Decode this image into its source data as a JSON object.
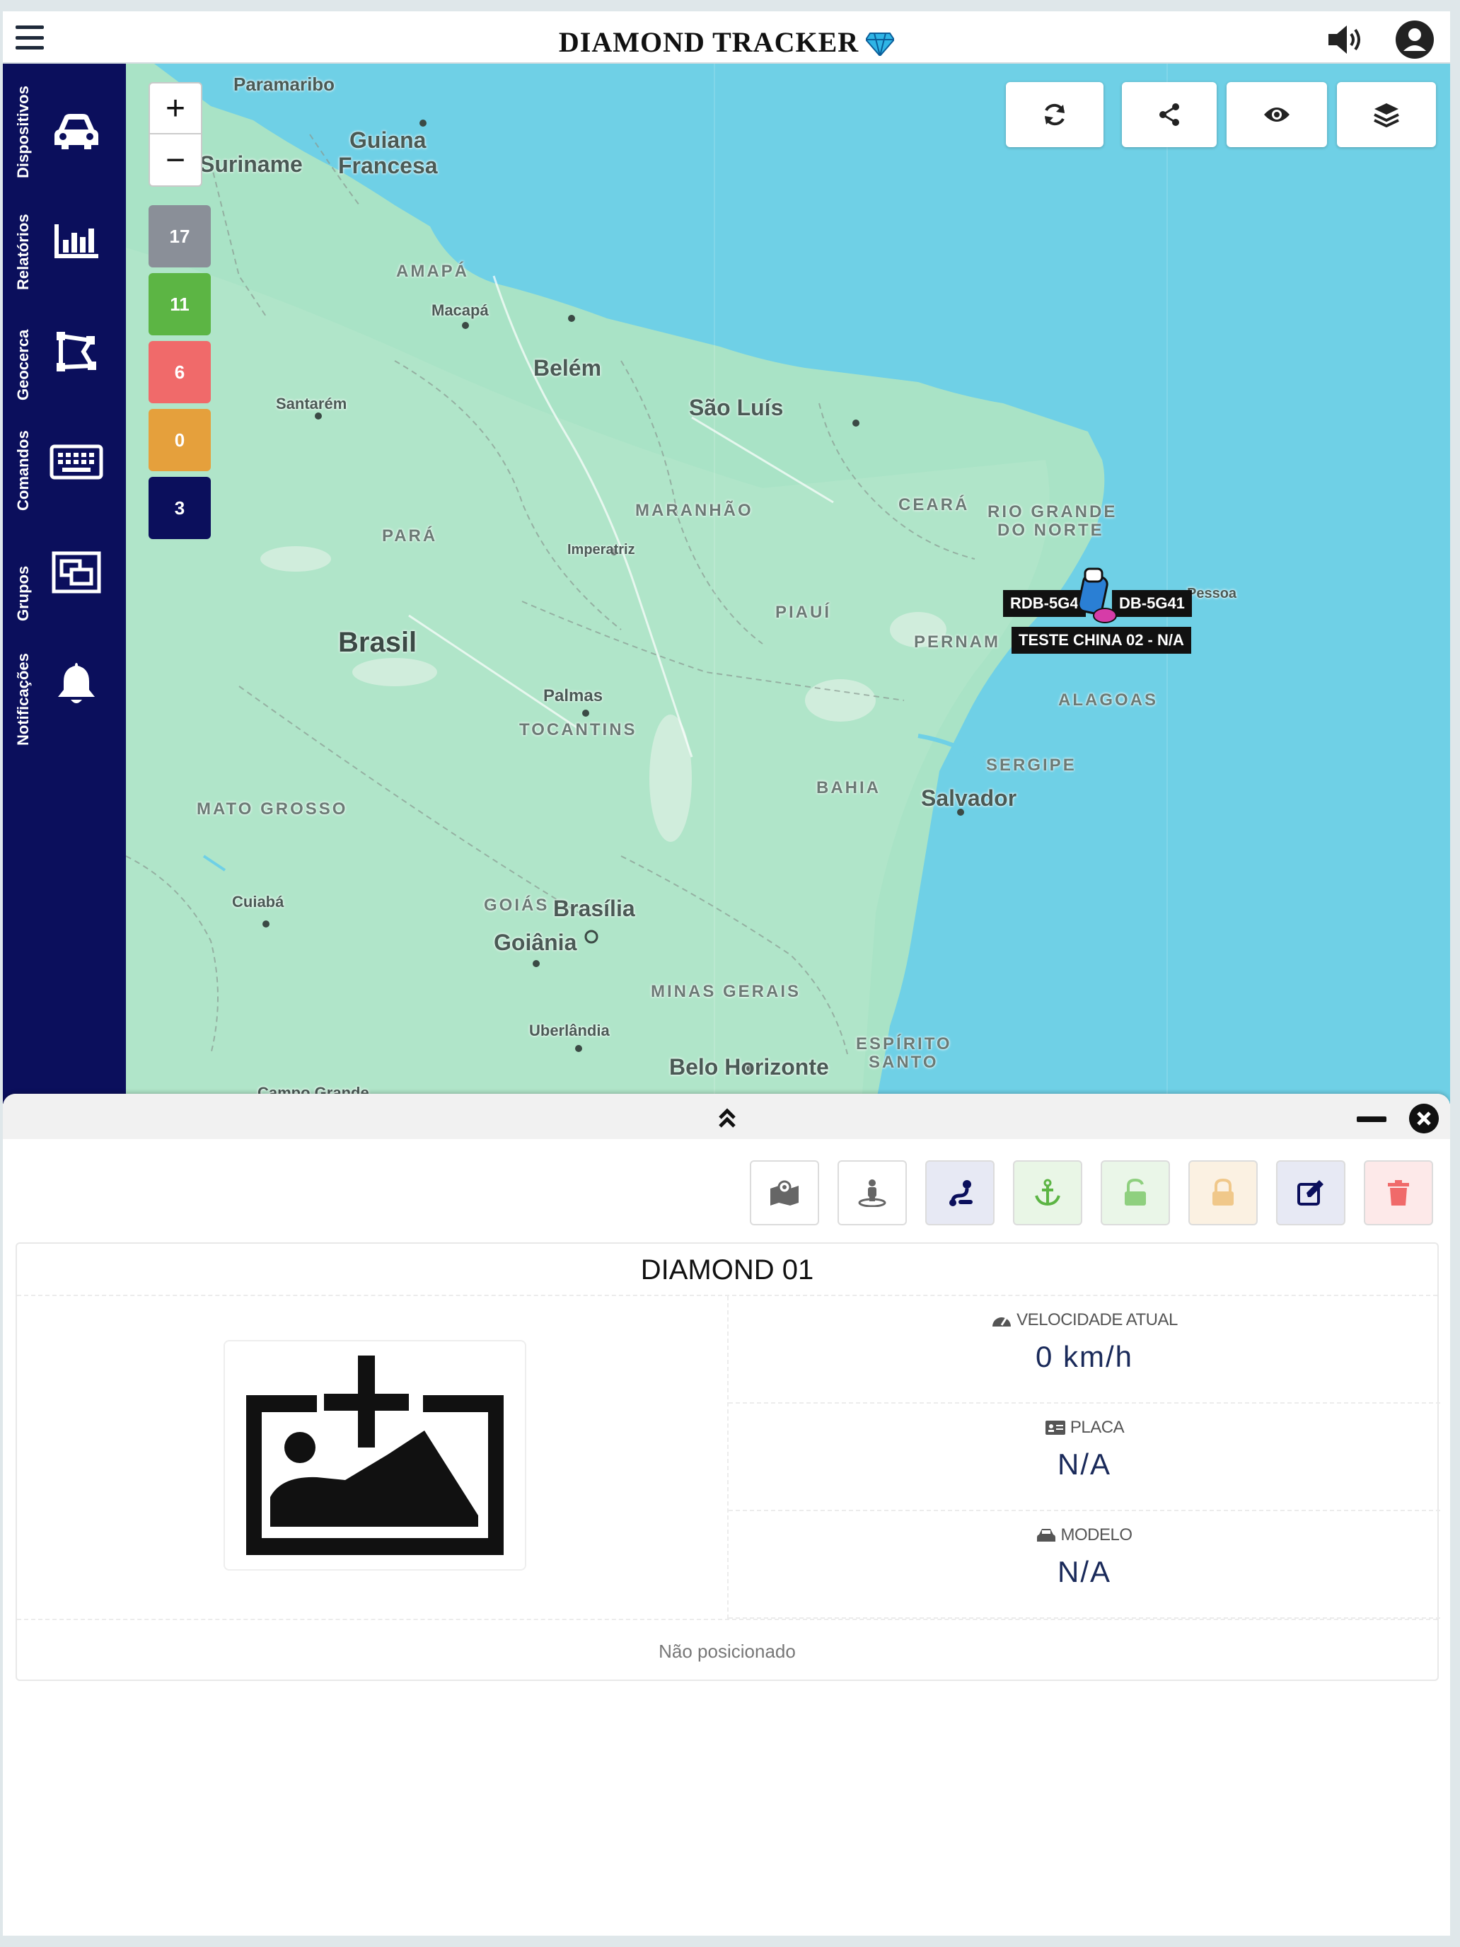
{
  "header": {
    "title": "DIAMOND TRACKER",
    "menu_icon": "hamburger-menu-icon",
    "sound_icon": "volume-icon",
    "account_icon": "user-circle-icon"
  },
  "sidebar": {
    "items": [
      {
        "label": "Dispositivos",
        "icon": "car-icon"
      },
      {
        "label": "Relatórios",
        "icon": "bar-chart-icon"
      },
      {
        "label": "Geocerca",
        "icon": "geofence-icon"
      },
      {
        "label": "Comandos",
        "icon": "keyboard-icon"
      },
      {
        "label": "Grupos",
        "icon": "group-icon"
      },
      {
        "label": "Notificações",
        "icon": "bell-icon"
      }
    ]
  },
  "map": {
    "zoom_in": "+",
    "zoom_out": "−",
    "counts": [
      {
        "value": "17",
        "color": "#8a8f98"
      },
      {
        "value": "11",
        "color": "#5cb544"
      },
      {
        "value": "6",
        "color": "#f06a6a"
      },
      {
        "value": "0",
        "color": "#e5a03c"
      },
      {
        "value": "3",
        "color": "#0b0f5c"
      }
    ],
    "tools": [
      "refresh-icon",
      "share-icon",
      "eye-icon",
      "layers-icon"
    ],
    "labels": {
      "paramaribo": "Paramaribo",
      "suriname": "Suriname",
      "guiana": "Guiana",
      "francesa": "Francesa",
      "amapa": "AMAPÁ",
      "macapa": "Macapá",
      "belem": "Belém",
      "sao_luis": "São Luís",
      "santarem": "Santarém",
      "maranhao": "MARANHÃO",
      "ceara": "CEARÁ",
      "rio_grande": "RIO GRANDE",
      "do_norte": "DO NORTE",
      "para": "PARÁ",
      "imperatriz": "Imperatriz",
      "piaui": "PIAUÍ",
      "pernam": "PERNAM",
      "brasil": "Brasil",
      "palmas": "Palmas",
      "tocantins": "TOCANTINS",
      "alagoas": "ALAGOAS",
      "sergipe": "SERGIPE",
      "bahia": "BAHIA",
      "salvador": "Salvador",
      "mato_grosso": "MATO GROSSO",
      "cuiaba": "Cuiabá",
      "goias": "GOIÁS",
      "brasilia": "Brasília",
      "goiania": "Goiânia",
      "minas_gerais": "MINAS GERAIS",
      "uberlandia": "Uberlândia",
      "espirito": "ESPÍRITO",
      "santo": "SANTO",
      "belo_horizonte": "Belo Horizonte",
      "campo_grande": "Campo Grande",
      "joao_pessoa": "Pessoa"
    },
    "markers": {
      "label_1": "RDB-5G4",
      "label_2": "DB-5G41",
      "label_3": "TESTE CHINA 02 - N/A"
    }
  },
  "panel": {
    "actions": [
      {
        "icon": "map-location-icon",
        "color": "#ffffff",
        "fg": "#555555"
      },
      {
        "icon": "street-view-icon",
        "color": "#ffffff",
        "fg": "#555555"
      },
      {
        "icon": "route-icon",
        "color": "#e7e9f4",
        "fg": "#0b0f5c"
      },
      {
        "icon": "anchor-icon",
        "color": "#e9f6e6",
        "fg": "#5cb544"
      },
      {
        "icon": "unlock-icon",
        "color": "#eaf6e8",
        "fg": "#8fd07f"
      },
      {
        "icon": "lock-icon",
        "color": "#fbf1e2",
        "fg": "#f0c88a"
      },
      {
        "icon": "edit-icon",
        "color": "#e7e9f4",
        "fg": "#0b0f5c"
      },
      {
        "icon": "trash-icon",
        "color": "#fde9e9",
        "fg": "#f06a6a"
      }
    ],
    "device_name": "DIAMOND 01",
    "fields": [
      {
        "label": "VELOCIDADE ATUAL",
        "value": "0 km/h",
        "icon": "speedometer-icon"
      },
      {
        "label": "PLACA",
        "value": "N/A",
        "icon": "id-card-icon"
      },
      {
        "label": "MODELO",
        "value": "N/A",
        "icon": "car-icon"
      }
    ],
    "status": "Não posicionado",
    "photo_icon": "add-image-icon"
  }
}
